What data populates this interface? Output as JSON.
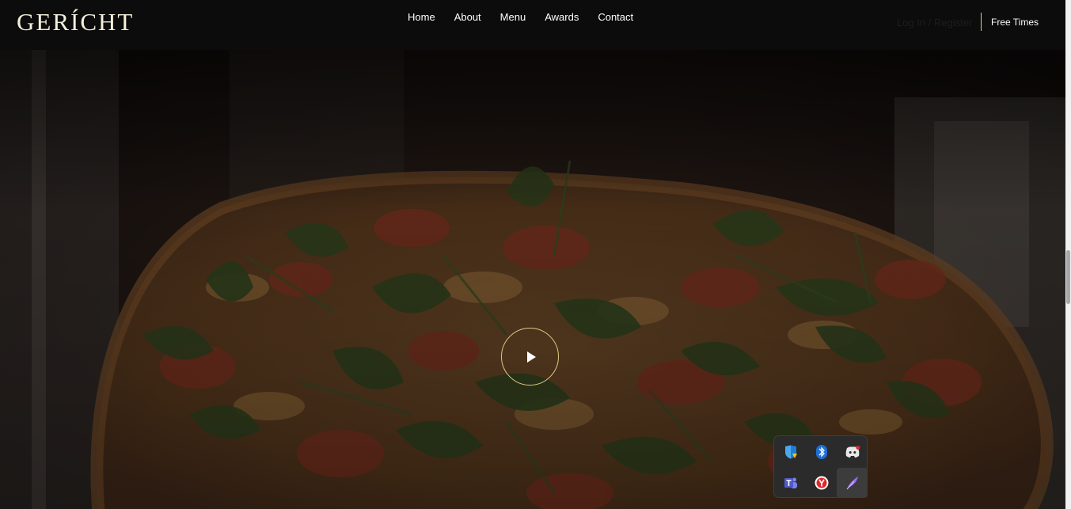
{
  "brand": {
    "logo": "GERÍCHT"
  },
  "nav": {
    "links": [
      {
        "label": "Home"
      },
      {
        "label": "About"
      },
      {
        "label": "Menu"
      },
      {
        "label": "Awards"
      },
      {
        "label": "Contact"
      }
    ],
    "login_label": "Log In / Register",
    "book_label": "Free Times"
  },
  "colors": {
    "background": "#0c0c0c",
    "accent_gold": "#dcca87",
    "logo_cream": "#f5efdb",
    "text_white": "#ffffff"
  },
  "hero": {
    "image_subject": "pepperoni pizza with arugula",
    "play_icon": "play-icon"
  },
  "tray": {
    "icons": [
      {
        "name": "windows-security-warning-icon"
      },
      {
        "name": "bluetooth-icon"
      },
      {
        "name": "discord-icon"
      },
      {
        "name": "microsoft-teams-icon"
      },
      {
        "name": "yandex-browser-icon"
      },
      {
        "name": "feather-pen-icon"
      }
    ]
  }
}
